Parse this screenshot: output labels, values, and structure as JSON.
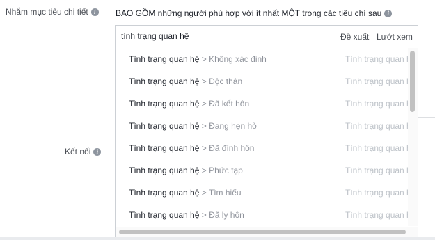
{
  "targeting": {
    "detailed_label": "Nhắm mục tiêu chi tiết",
    "include_text": "BAO GỒM những người phù hợp với ít nhất MỘT trong các tiêu chí sau",
    "connections_label": "Kết nối"
  },
  "search": {
    "value": "tình trạng quan hệ",
    "suggestions_label": "Đề xuất",
    "browse_label": "Lướt xem"
  },
  "results": [
    {
      "main": "Tình trạng quan hệ",
      "sub": " > Không xác định",
      "right": "Tình trạng quan hệ"
    },
    {
      "main": "Tình trạng quan hệ",
      "sub": " > Độc thân",
      "right": "Tình trạng quan hệ"
    },
    {
      "main": "Tình trạng quan hệ",
      "sub": " > Đã kết hôn",
      "right": "Tình trạng quan hệ"
    },
    {
      "main": "Tình trạng quan hệ",
      "sub": " > Đang hẹn hò",
      "right": "Tình trạng quan hệ"
    },
    {
      "main": "Tình trạng quan hệ",
      "sub": " > Đã đính hôn",
      "right": "Tình trạng quan hệ"
    },
    {
      "main": "Tình trạng quan hệ",
      "sub": " > Phức tạp",
      "right": "Tình trạng quan hệ"
    },
    {
      "main": "Tình trạng quan hệ",
      "sub": " > Tìm hiểu",
      "right": "Tình trạng quan hệ"
    },
    {
      "main": "Tình trạng quan hệ",
      "sub": " > Đã ly hôn",
      "right": "Tình trạng quan hệ"
    }
  ],
  "icons": {
    "info": "info-icon"
  },
  "colors": {
    "muted": "#90949c",
    "border": "#ccd0d5",
    "text": "#1d2129"
  }
}
